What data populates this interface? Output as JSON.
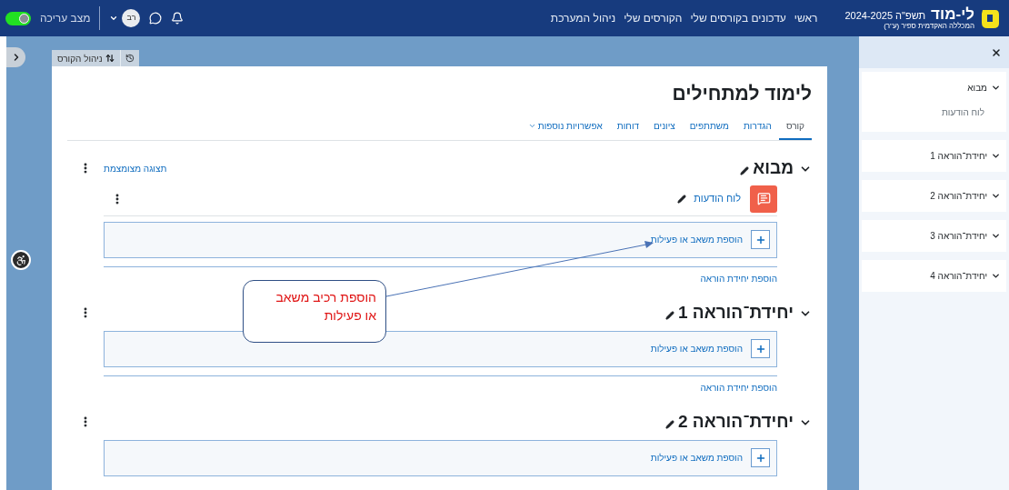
{
  "top_bar": {
    "logo_text": "לי-מוד",
    "year": "תשפ\"ה 2024-2025",
    "institution": "המכללה האקדמית ספיר (ע\"ר)",
    "nav": [
      "ראשי",
      "עדכונים בקורסים שלי",
      "הקורסים שלי",
      "ניהול המערכת"
    ],
    "avatar_initials": "רב",
    "edit_mode": {
      "label": "מצב עריכה",
      "on": true
    }
  },
  "course_toolbar": {
    "label": "ניהול הקורס"
  },
  "course": {
    "title": "לימוד למתחילים",
    "tabs": [
      {
        "label": "קורס",
        "selected": true,
        "menu": false
      },
      {
        "label": "הגדרות",
        "selected": false,
        "menu": false
      },
      {
        "label": "משתתפים",
        "selected": false,
        "menu": false
      },
      {
        "label": "ציונים",
        "selected": false,
        "menu": false
      },
      {
        "label": "דוחות",
        "selected": false,
        "menu": false
      },
      {
        "label": "אפשרויות נוספות",
        "selected": false,
        "menu": true
      }
    ],
    "collapse_link": "תצוגה מצומצמת",
    "sections": [
      {
        "title": "מבוא",
        "expanded": true,
        "activities": [
          {
            "name": "לוח הודעות"
          }
        ],
        "add_activity": "הוספת משאב או פעילות",
        "add_section": "הוספת יחידת הוראה"
      },
      {
        "title": "יחידת־הוראה 1",
        "expanded": true,
        "add_activity": "הוספת משאב או פעילות",
        "add_section": "הוספת יחידת הוראה"
      },
      {
        "title": "יחידת־הוראה 2",
        "expanded": true,
        "add_activity": "הוספת משאב או פעילות"
      }
    ]
  },
  "callout": {
    "lines": [
      "הוספת רכיב משאב",
      "או פעילות"
    ]
  },
  "course_index": {
    "items": [
      {
        "title": "מבוא",
        "expanded": true,
        "children": [
          {
            "title": "לוח הודעות"
          }
        ]
      },
      {
        "title": "יחידת־הוראה 1",
        "expanded": true
      },
      {
        "title": "יחידת־הוראה 2",
        "expanded": true
      },
      {
        "title": "יחידת־הוראה 3",
        "expanded": true
      },
      {
        "title": "יחידת־הוראה 4",
        "expanded": true
      }
    ]
  }
}
